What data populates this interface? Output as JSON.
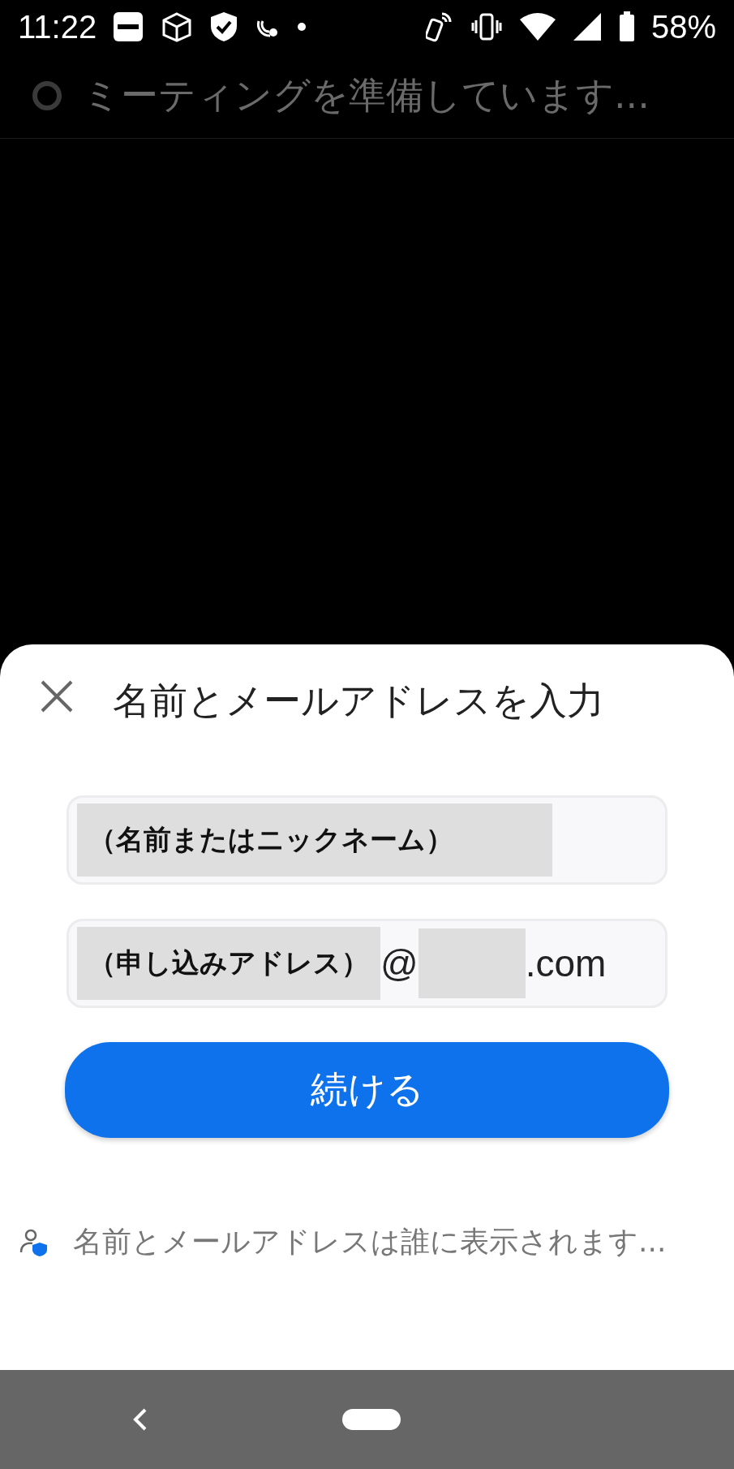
{
  "status_bar": {
    "time": "11:22",
    "battery": "58%"
  },
  "header": {
    "text": "ミーティングを準備しています..."
  },
  "sheet": {
    "title": "名前とメールアドレスを入力",
    "fields": [
      {
        "parts": [
          {
            "kind": "redacted",
            "text": "（名前またはニックネーム）"
          }
        ]
      },
      {
        "parts": [
          {
            "kind": "redacted",
            "text": "（申し込みアドレス）"
          },
          {
            "kind": "plain",
            "text": "@"
          },
          {
            "kind": "blank"
          },
          {
            "kind": "plain",
            "text": ".com"
          }
        ]
      }
    ],
    "button": "続ける",
    "note": "名前とメールアドレスは誰に表示されます..."
  }
}
